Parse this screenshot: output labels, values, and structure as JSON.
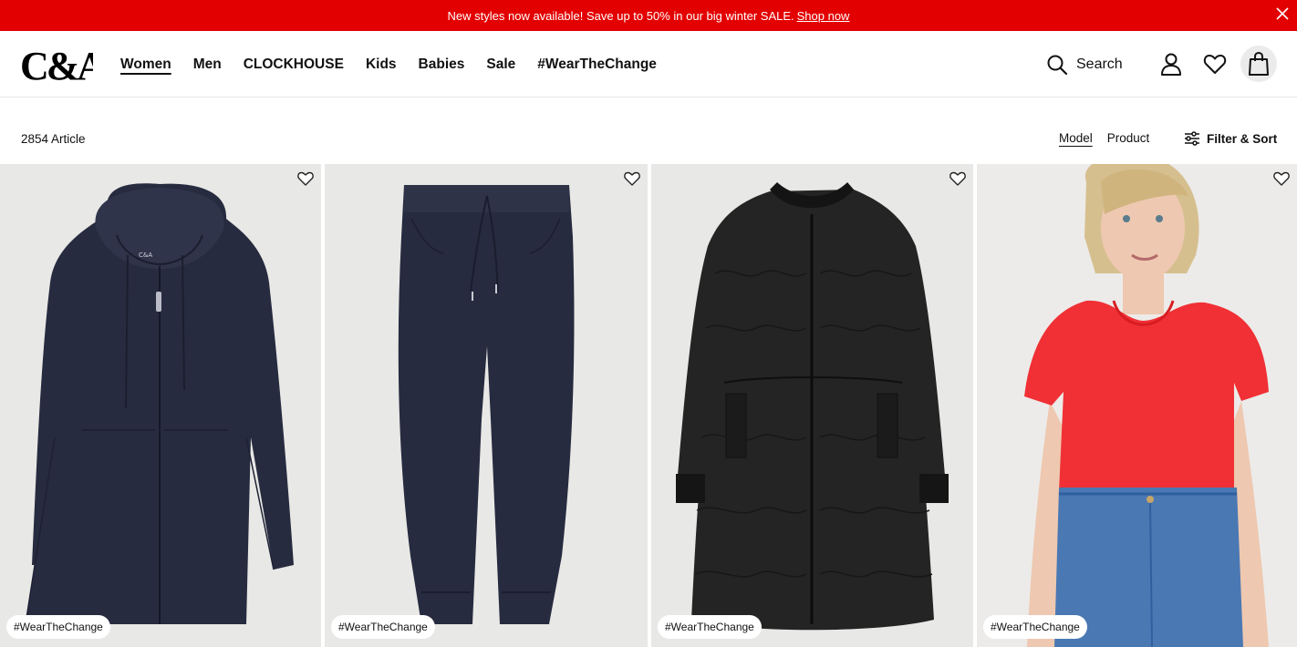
{
  "promo": {
    "message": "New styles now available! Save up to 50% in our big winter SALE.",
    "link_label": "Shop now"
  },
  "header": {
    "logo_text": "C&A",
    "nav": [
      {
        "label": "Women",
        "active": true
      },
      {
        "label": "Men"
      },
      {
        "label": "CLOCKHOUSE"
      },
      {
        "label": "Kids"
      },
      {
        "label": "Babies"
      },
      {
        "label": "Sale"
      },
      {
        "label": "#WearTheChange"
      }
    ],
    "search_label": "Search"
  },
  "toolbar": {
    "article_count": "2854 Article",
    "view_options": [
      "Model",
      "Product"
    ],
    "view_active": "Model",
    "filter_label": "Filter & Sort"
  },
  "products": [
    {
      "tag": "#WearTheChange",
      "image": "navy-zip-hoodie"
    },
    {
      "tag": "#WearTheChange",
      "image": "navy-jogger-pants"
    },
    {
      "tag": "#WearTheChange",
      "image": "black-quilted-long-jacket"
    },
    {
      "tag": "#WearTheChange",
      "image": "model-red-tshirt-blue-jeans"
    }
  ],
  "colors": {
    "promo_bg": "#e30000",
    "navy": "#272b3f",
    "black_jacket": "#242424",
    "red_top": "#f03035",
    "denim": "#4a78b3"
  }
}
